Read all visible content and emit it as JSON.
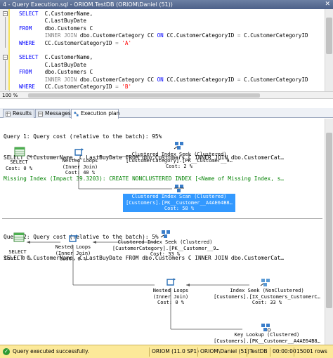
{
  "window": {
    "title": "4 - Query Execution.sql - ORIOM.TestDB (ORIOM\\Daniel (51))"
  },
  "editor": {
    "zoom": "100 %",
    "lines": [
      [
        {
          "t": "SELECT  ",
          "c": "kw"
        },
        {
          "t": "C.CustomerName,",
          "c": ""
        }
      ],
      [
        {
          "t": "        C.LastBuyDate",
          "c": ""
        }
      ],
      [
        {
          "t": "FROM    ",
          "c": "kw"
        },
        {
          "t": "dbo.Customers C",
          "c": ""
        }
      ],
      [
        {
          "t": "        INNER JOIN ",
          "c": "gr"
        },
        {
          "t": "dbo.CustomerCategory CC ",
          "c": ""
        },
        {
          "t": "ON ",
          "c": "kw"
        },
        {
          "t": "CC.CustomerCategoryID ",
          "c": ""
        },
        {
          "t": "= ",
          "c": "gr"
        },
        {
          "t": "C.CustomerCategoryID",
          "c": ""
        }
      ],
      [
        {
          "t": "WHERE   ",
          "c": "kw"
        },
        {
          "t": "CC.CustomerCategoryID ",
          "c": ""
        },
        {
          "t": "= ",
          "c": "gr"
        },
        {
          "t": "'A'",
          "c": "st"
        }
      ],
      [
        {
          "t": "",
          "c": ""
        }
      ],
      [
        {
          "t": "SELECT  ",
          "c": "kw"
        },
        {
          "t": "C.CustomerName,",
          "c": ""
        }
      ],
      [
        {
          "t": "        C.LastBuyDate",
          "c": ""
        }
      ],
      [
        {
          "t": "FROM    ",
          "c": "kw"
        },
        {
          "t": "dbo.Customers C",
          "c": ""
        }
      ],
      [
        {
          "t": "        INNER JOIN ",
          "c": "gr"
        },
        {
          "t": "dbo.CustomerCategory CC ",
          "c": ""
        },
        {
          "t": "ON ",
          "c": "kw"
        },
        {
          "t": "CC.CustomerCategoryID ",
          "c": ""
        },
        {
          "t": "= ",
          "c": "gr"
        },
        {
          "t": "C.CustomerCategoryID",
          "c": ""
        }
      ],
      [
        {
          "t": "WHERE   ",
          "c": "kw"
        },
        {
          "t": "CC.CustomerCategoryID ",
          "c": ""
        },
        {
          "t": "= ",
          "c": "gr"
        },
        {
          "t": "'B'",
          "c": "st"
        }
      ]
    ]
  },
  "tabs": [
    {
      "label": "Results",
      "icon": "results-grid-icon"
    },
    {
      "label": "Messages",
      "icon": "messages-icon"
    },
    {
      "label": "Execution plan",
      "icon": "execution-plan-icon"
    }
  ],
  "plan": {
    "query1": {
      "line1": "Query 1: Query cost (relative to the batch): 95%",
      "line2": "SELECT C.CustomerName, C.LastBuyDate FROM dbo.Customers C INNER JOIN dbo.CustomerCat…",
      "line3": "Missing Index (Impact 39.3203): CREATE NONCLUSTERED INDEX [<Name of Missing Index, s…",
      "nodes": {
        "select": "SELECT\nCost: 0 %",
        "nested": "Nested Loops\n(Inner Join)\nCost: 40 %",
        "seek": "Clustered Index Seek (Clustered)\n[CustomerCategory].[PK__Customer__9…\nCost: 2 %",
        "scan": "Clustered Index Scan (Clustered)\n[Customers].[PK__Customer__A4AE64B8…\nCost: 58 %"
      }
    },
    "query2": {
      "line1": "Query 2: Query cost (relative to the batch): 5%",
      "line2": "SELECT C.CustomerName, C.LastBuyDate FROM dbo.Customers C INNER JOIN dbo.CustomerCat…",
      "nodes": {
        "select": "SELECT\nCost: 0 %",
        "nested1": "Nested Loops\n(Inner Join)\nCost: 0 %",
        "seek": "Clustered Index Seek (Clustered)\n[CustomerCategory].[PK__Customer__9…\nCost: 33 %",
        "nested2": "Nested Loops\n(Inner Join)\nCost: 0 %",
        "ixseek": "Index Seek (NonClustered)\n[Customers].[IX_Customers_CustomerC…\nCost: 33 %",
        "lookup": "Key Lookup (Clustered)\n[Customers].[PK__Customer__A4AE64B8…"
      }
    }
  },
  "status": {
    "message": "Query executed successfully.",
    "server": "ORIOM (11.0 SP1)",
    "user": "ORIOM\\Daniel (51)",
    "db": "TestDB",
    "time": "00:00:00",
    "rows": "15001 rows"
  },
  "colors": {
    "status_bg": "#fce999",
    "selection": "#3399ff",
    "keyword": "#0000ff",
    "missing_index": "#008000"
  }
}
